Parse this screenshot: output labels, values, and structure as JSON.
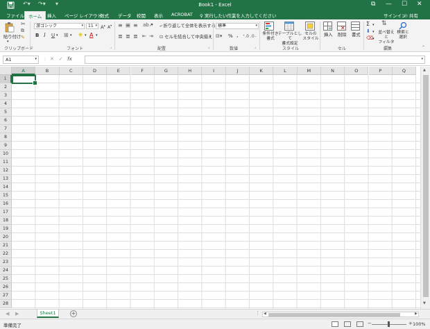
{
  "window": {
    "title": "Book1 - Excel",
    "controls": [
      "⧉",
      "—",
      "☐",
      "✕"
    ]
  },
  "ribbon_tabs": [
    "ファイル",
    "ホーム",
    "挿入",
    "ページ レイアウト",
    "数式",
    "データ",
    "校閲",
    "表示",
    "ACROBAT"
  ],
  "active_tab": "ホーム",
  "tell_me": "実行したい作業を入力してください",
  "signin": "サインイン",
  "share": "共有",
  "clipboard": {
    "paste": "貼り付け",
    "label": "クリップボード"
  },
  "font": {
    "name": "游ゴシック",
    "size": "11",
    "bold": "B",
    "italic": "I",
    "underline": "U",
    "label": "フォント"
  },
  "alignment": {
    "wrap_text": "折り返して全体を表示する",
    "merge_center": "セルを結合して中央揃え",
    "label": "配置"
  },
  "number": {
    "format": "標準",
    "percent": "%",
    "comma": ",",
    "label": "数値"
  },
  "styles": {
    "conditional": "条件付き\n書式",
    "table": "テーブルとして\n書式設定",
    "cell_styles": "セルの\nスタイル",
    "label": "スタイル"
  },
  "cells_group": {
    "insert": "挿入",
    "delete": "削除",
    "format": "書式",
    "label": "セル"
  },
  "editing": {
    "sort_filter": "並べ替えと\nフィルター",
    "find_select": "検索と\n選択",
    "label": "編集"
  },
  "formula_bar": {
    "name_box": "A1",
    "fx": "fx",
    "cancel": "✕",
    "enter": "✓",
    "content": ""
  },
  "columns": [
    "A",
    "B",
    "C",
    "D",
    "E",
    "F",
    "G",
    "H",
    "I",
    "J",
    "K",
    "L",
    "M",
    "N",
    "O",
    "P",
    "Q"
  ],
  "rows": [
    "1",
    "2",
    "3",
    "4",
    "5",
    "6",
    "7",
    "8",
    "9",
    "10",
    "11",
    "12",
    "13",
    "14",
    "15",
    "16",
    "17",
    "18",
    "19",
    "20",
    "21",
    "22",
    "23",
    "24",
    "25",
    "26",
    "27",
    "28"
  ],
  "active_cell": "A1",
  "sheet": {
    "tabs": [
      "Sheet1"
    ],
    "add": "+"
  },
  "status": {
    "text": "準備完了",
    "zoom": "100%",
    "zoom_out": "−",
    "zoom_in": "+"
  },
  "colors": {
    "accent": "#217346",
    "ribbon_bg": "#f3f3f3",
    "grid_line": "#dedede"
  }
}
